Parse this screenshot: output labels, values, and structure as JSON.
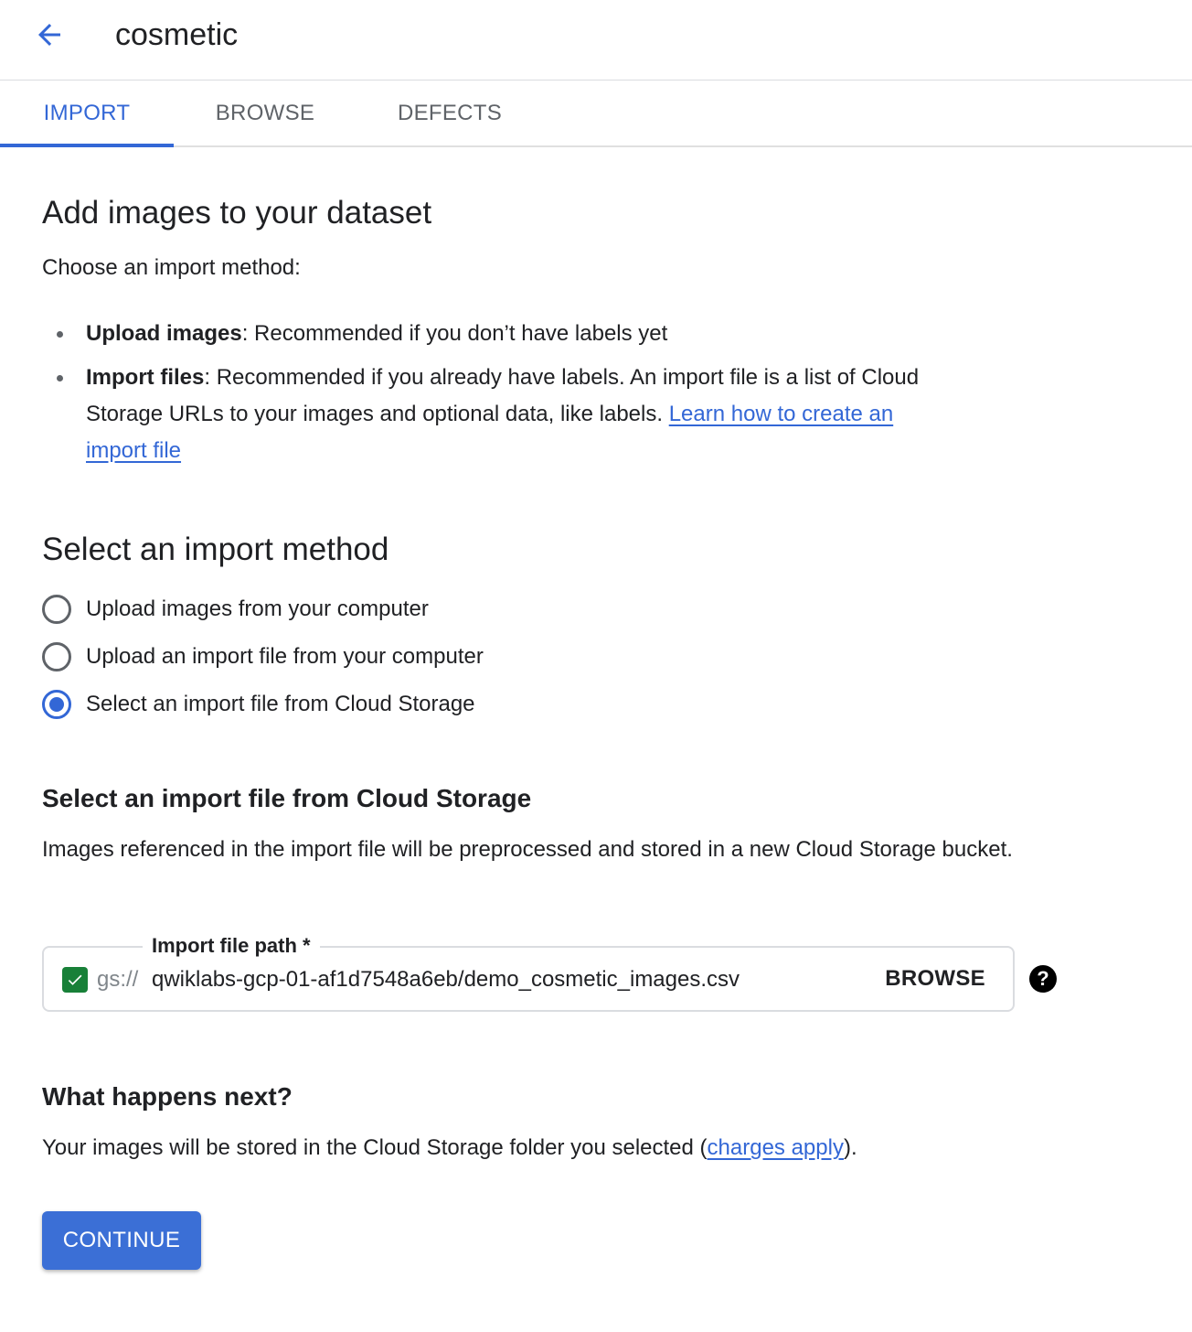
{
  "header": {
    "title": "cosmetic"
  },
  "tabs": [
    {
      "label": "IMPORT"
    },
    {
      "label": "BROWSE"
    },
    {
      "label": "DEFECTS"
    }
  ],
  "intro": {
    "heading": "Add images to your dataset",
    "subheading": "Choose an import method:",
    "bullets": [
      {
        "bold": "Upload images",
        "text": ": Recommended if you don’t have labels yet"
      },
      {
        "bold": "Import files",
        "text": ": Recommended if you already have labels. An import file is a list of Cloud Storage URLs to your images and optional data, like labels. ",
        "link": "Learn how to create an import file"
      }
    ]
  },
  "method": {
    "heading": "Select an import method",
    "options": [
      {
        "label": "Upload images from your computer",
        "selected": false
      },
      {
        "label": "Upload an import file from your computer",
        "selected": false
      },
      {
        "label": "Select an import file from Cloud Storage",
        "selected": true
      }
    ]
  },
  "cloud_storage": {
    "heading": "Select an import file from Cloud Storage",
    "description": "Images referenced in the import file will be preprocessed and stored in a new Cloud Storage bucket.",
    "field_label": "Import file path *",
    "prefix": "gs://",
    "value": "qwiklabs-gcp-01-af1d7548a6eb/demo_cosmetic_images.csv",
    "browse_label": "BROWSE",
    "help_icon": "?"
  },
  "next": {
    "heading": "What happens next?",
    "text_before": "Your images will be stored in the Cloud Storage folder you selected (",
    "link": "charges apply",
    "text_after": ")."
  },
  "continue_label": "CONTINUE",
  "colors": {
    "accent": "#3367d6",
    "success": "#188038",
    "divider": "#dadce0"
  }
}
